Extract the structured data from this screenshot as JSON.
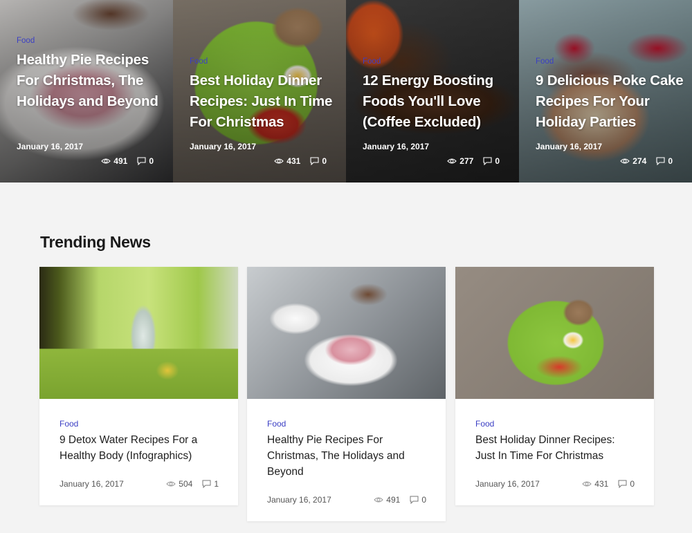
{
  "hero": {
    "cards": [
      {
        "category": "Food",
        "title": "Healthy Pie Recipes For Christmas, The Holidays and Beyond",
        "date": "January 16, 2017",
        "views": "491",
        "comments": "0",
        "image": "pie-slice-photo"
      },
      {
        "category": "Food",
        "title": "Best Holiday Dinner Recipes: Just In Time For Christmas",
        "date": "January 16, 2017",
        "views": "431",
        "comments": "0",
        "image": "green-plate-dinner-photo"
      },
      {
        "category": "Food",
        "title": "12 Energy Boosting Foods You'll Love (Coffee Excluded)",
        "date": "January 16, 2017",
        "views": "277",
        "comments": "0",
        "image": "coffee-beans-photo"
      },
      {
        "category": "Food",
        "title": "9 Delicious Poke Cake Recipes For Your Holiday Parties",
        "date": "January 16, 2017",
        "views": "274",
        "comments": "0",
        "image": "poke-cake-photo"
      }
    ]
  },
  "trending": {
    "heading": "Trending News",
    "cards": [
      {
        "category": "Food",
        "title": "9 Detox Water Recipes For a Healthy Body (Infographics)",
        "date": "January 16, 2017",
        "views": "504",
        "comments": "1",
        "image": "detox-water-photo"
      },
      {
        "category": "Food",
        "title": "Healthy Pie Recipes For Christmas, The Holidays and Beyond",
        "date": "January 16, 2017",
        "views": "491",
        "comments": "0",
        "image": "pie-slice-photo"
      },
      {
        "category": "Food",
        "title": "Best Holiday Dinner Recipes: Just In Time For Christmas",
        "date": "January 16, 2017",
        "views": "431",
        "comments": "0",
        "image": "green-plate-dinner-photo"
      }
    ]
  },
  "icons": {
    "views": "eye-icon",
    "comments": "comment-icon"
  },
  "colors": {
    "category": "#3b3fc4",
    "background": "#f3f3f3",
    "card": "#ffffff",
    "heading": "#1a1a1a"
  }
}
